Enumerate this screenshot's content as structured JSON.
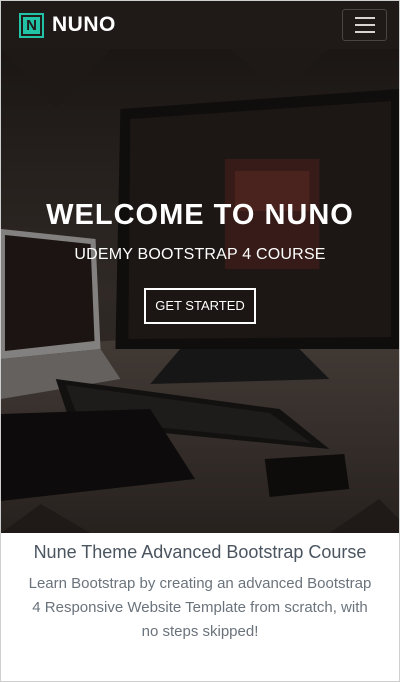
{
  "navbar": {
    "brand_letter": "N",
    "brand_text": "NUNO",
    "accent_color": "#21c2a6",
    "toggler_icon": "hamburger-menu-icon"
  },
  "hero": {
    "title": "WELCOME TO NUNO",
    "subtitle": "UDEMY BOOTSTRAP 4 COURSE",
    "button_label": "GET STARTED"
  },
  "intro": {
    "heading": "Nune Theme Advanced Bootstrap Course",
    "text": "Learn Bootstrap by creating an advanced Bootstrap 4 Responsive Website Template from scratch, with no steps skipped!"
  }
}
